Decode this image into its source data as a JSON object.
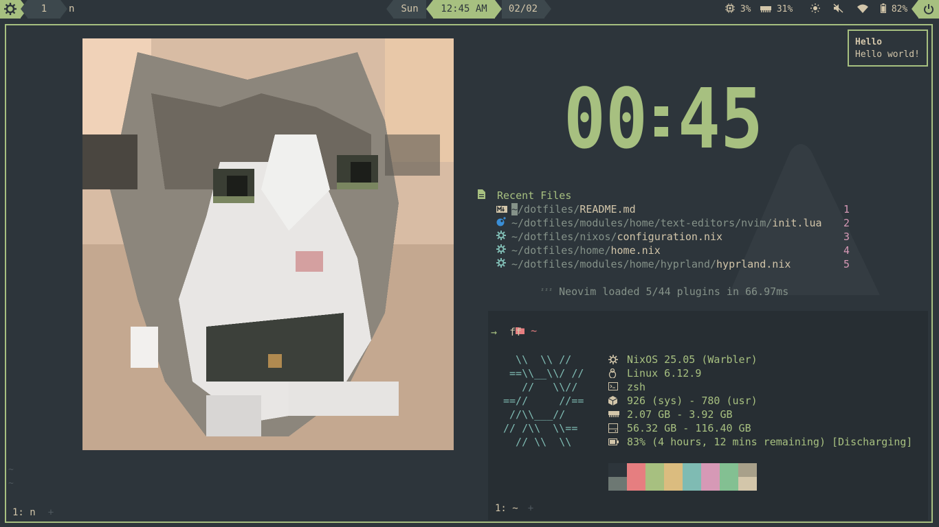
{
  "topbar": {
    "workspace": "1",
    "window_title": "n",
    "day": "Sun",
    "time": "12:45 AM",
    "date": "02/02",
    "cpu": "3%",
    "memory": "31%",
    "battery": "82%",
    "icons": [
      "nixos-gear-icon",
      "cpu-icon",
      "memory-icon",
      "brightness-icon",
      "mute-icon",
      "wifi-icon",
      "battery-icon",
      "power-icon"
    ]
  },
  "notification": {
    "title": "Hello",
    "body": "Hello world!"
  },
  "clock": {
    "hh": "00",
    "mm": "45"
  },
  "recent": {
    "header": "Recent Files",
    "files": [
      {
        "icon": "markdown-icon",
        "cursor": "~",
        "dir": "/dotfiles/",
        "name": "README.md",
        "num": "1"
      },
      {
        "icon": "lua-icon",
        "cursor": "",
        "dir": "~/dotfiles/modules/home/text-editors/nvim/",
        "name": "init.lua",
        "num": "2"
      },
      {
        "icon": "nix-icon",
        "cursor": "",
        "dir": "~/dotfiles/nixos/",
        "name": "configuration.nix",
        "num": "3"
      },
      {
        "icon": "nix-icon",
        "cursor": "",
        "dir": "~/dotfiles/home/",
        "name": "home.nix",
        "num": "4"
      },
      {
        "icon": "nix-icon",
        "cursor": "",
        "dir": "~/dotfiles/modules/home/hyprland/",
        "name": "hyprland.nix",
        "num": "5"
      }
    ],
    "status": "Neovim loaded 5/44 plugins in 66.97ms"
  },
  "nvim": {
    "tilde": "~",
    "statusline": "1: n",
    "plus": "+"
  },
  "terminal": {
    "cwd": "~",
    "prompt_arrow": "→",
    "command": "ff",
    "ascii": [
      "  \\\\  \\\\ //",
      " ==\\\\__\\\\/ //",
      "   //   \\\\//",
      "==//     //==",
      " //\\\\___//",
      "// /\\\\  \\\\==",
      "  // \\\\  \\\\"
    ],
    "fetch": [
      {
        "icon": "nixos-icon",
        "value": "NixOS 25.05 (Warbler)"
      },
      {
        "icon": "linux-icon",
        "value": "Linux 6.12.9"
      },
      {
        "icon": "shell-icon",
        "value": "zsh"
      },
      {
        "icon": "package-icon",
        "value": "926 (sys) - 780 (usr)"
      },
      {
        "icon": "memory-icon",
        "value": "2.07 GB - 3.92 GB"
      },
      {
        "icon": "disk-icon",
        "value": "56.32 GB - 116.40 GB"
      },
      {
        "icon": "battery-icon",
        "value": "83% (4 hours, 12 mins remaining) [Discharging]"
      }
    ],
    "palette_top": [
      "#2d353b",
      "#e67e80",
      "#a7c080",
      "#dbbc7f",
      "#7fbbb3",
      "#d699b6",
      "#83c092",
      "#a8a08a"
    ],
    "palette_bottom": [
      "#6d7873",
      "#e67e80",
      "#a7c080",
      "#dbbc7f",
      "#7fbbb3",
      "#d699b6",
      "#83c092",
      "#d3c6aa"
    ],
    "statusline": "1: ~",
    "plus": "+"
  },
  "colors": {
    "accent": "#a7c080",
    "bg": "#2d353b",
    "fg": "#d3c6aa"
  }
}
